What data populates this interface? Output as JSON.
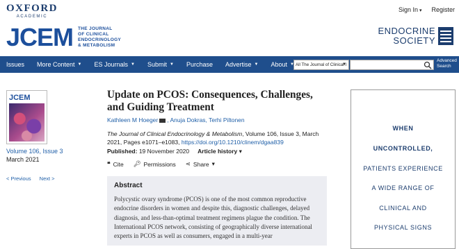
{
  "brand": {
    "publisher_line1": "OXFORD",
    "publisher_line2": "ACADEMIC",
    "journal_abbr": "JCEM",
    "journal_full": [
      "THE JOURNAL",
      "OF CLINICAL",
      "ENDOCRINOLOGY",
      "& METABOLISM"
    ],
    "society_line1": "ENDOCRINE",
    "society_line2": "SOCIETY"
  },
  "toplinks": {
    "signin": "Sign In",
    "register": "Register"
  },
  "nav": {
    "items": [
      {
        "label": "Issues",
        "dropdown": false
      },
      {
        "label": "More Content",
        "dropdown": true
      },
      {
        "label": "ES Journals",
        "dropdown": true
      },
      {
        "label": "Submit",
        "dropdown": true
      },
      {
        "label": "Purchase",
        "dropdown": false
      },
      {
        "label": "Advertise",
        "dropdown": true
      },
      {
        "label": "About",
        "dropdown": true
      }
    ],
    "search_scope": "All The Journal of Clinical I",
    "advanced_line1": "Advanced",
    "advanced_line2": "Search"
  },
  "issue": {
    "cover_title": "JCEM",
    "volume": "Volume 106, Issue 3",
    "date": "March 2021",
    "prev": "< Previous",
    "next": "Next >"
  },
  "article": {
    "title": "Update on PCOS: Consequences, Challenges, and Guiding Treatment",
    "author1": "Kathleen M Hoeger",
    "author2": "Anuja Dokras",
    "author3": "Terhi Piltonen",
    "citation_journal": "The Journal of Clinical Endocrinology & Metabolism",
    "citation_rest": ", Volume 106, Issue 3, March 2021, Pages e1071–e1083,",
    "doi": "https://doi.org/10.1210/clinem/dgaa839",
    "published_label": "Published:",
    "published_date": "19 November 2020",
    "history_label": "Article history"
  },
  "tools": {
    "cite": "Cite",
    "permissions": "Permissions",
    "share": "Share"
  },
  "abstract": {
    "heading": "Abstract",
    "text": "Polycystic ovary syndrome (PCOS) is one of the most common reproductive endocrine disorders in women and despite this, diagnostic challenges, delayed diagnosis, and less-than-optimal treatment regimens plague the condition. The International PCOS network, consisting of geographically diverse international experts in PCOS as well as consumers, engaged in a multi-year"
  },
  "ad": {
    "lines": [
      "WHEN",
      "UNCONTROLLED,",
      "PATIENTS EXPERIENCE",
      "A WIDE RANGE OF",
      "CLINICAL AND",
      "PHYSICAL SIGNS"
    ]
  }
}
